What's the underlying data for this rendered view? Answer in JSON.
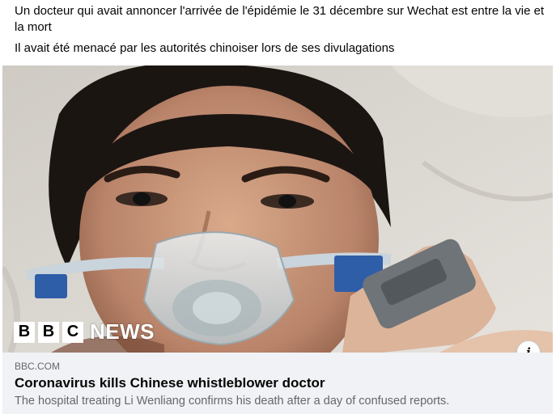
{
  "post": {
    "text_line1": "Un docteur qui avait annoncer l'arrivée de l'épidémie le 31 décembre sur Wechat  est entre la vie et la mort",
    "text_line2": "Il avait été menacé par les autorités chinoiser lors de ses divulagations"
  },
  "media": {
    "logo_letters": [
      "B",
      "B",
      "C"
    ],
    "logo_word": "NEWS"
  },
  "info_button": {
    "label": "i",
    "icon": "info-icon"
  },
  "link_preview": {
    "domain": "BBC.COM",
    "title": "Coronavirus kills Chinese whistleblower doctor",
    "description": "The hospital treating Li Wenliang confirms his death after a day of confused reports."
  },
  "colors": {
    "secondary_text": "#65676b",
    "preview_bg": "#f0f2f5",
    "primary_text": "#050505"
  }
}
